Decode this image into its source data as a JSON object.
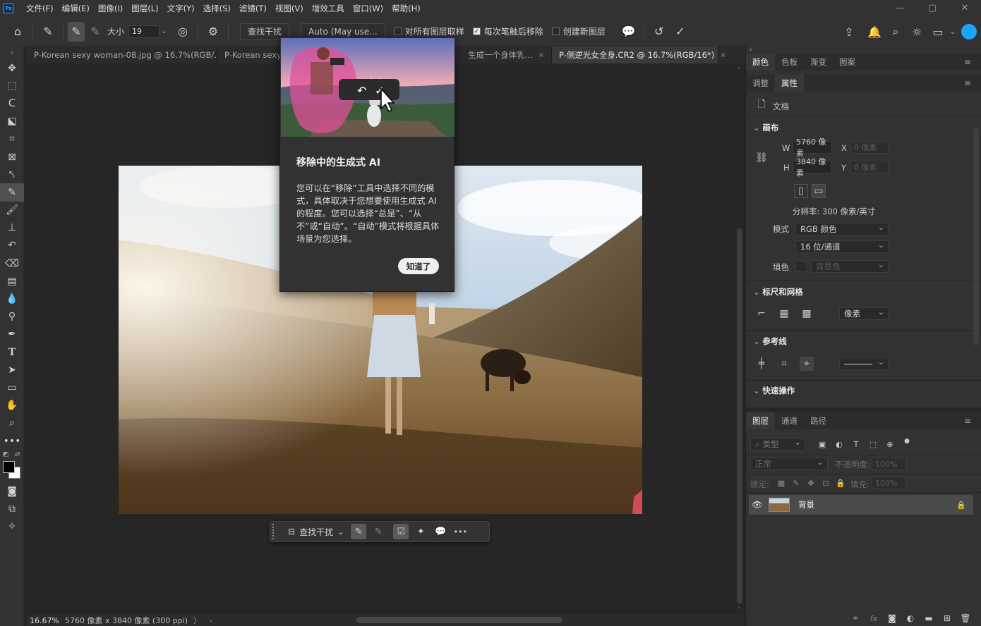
{
  "app": {
    "logo": "Ps",
    "menu": [
      "文件(F)",
      "编辑(E)",
      "图像(I)",
      "图层(L)",
      "文字(Y)",
      "选择(S)",
      "滤镜(T)",
      "视图(V)",
      "增效工具",
      "窗口(W)",
      "帮助(H)"
    ],
    "window_controls": [
      "—",
      "▢",
      "✕"
    ]
  },
  "options": {
    "size_label": "大小",
    "size_value": "19",
    "find_distractions": "查找干扰",
    "mode": "Auto (May use...",
    "sample_all_layers": "对所有图层取样",
    "remove_after_stroke": "每次笔触后移除",
    "create_new_layer": "创建新图层"
  },
  "tabs": [
    {
      "label": "P-Korean sexy woman-08.jpg @ 16.7%(RGB/..."
    },
    {
      "label": "P-Korean sexy w"
    },
    {
      "label": "生成一个身体乳..."
    },
    {
      "label": "P-侧逆光女全身.CR2 @ 16.7%(RGB/16*)"
    }
  ],
  "tab_close": "×",
  "status": {
    "zoom": "16.67%",
    "info": "5760 像素 x 3840 像素 (300 ppi)",
    "arrow": "〉",
    "left": "‹"
  },
  "contextbar": {
    "find_distractions": "查找干扰",
    "more": "•••"
  },
  "popup": {
    "title": "移除中的生成式 AI",
    "body": "您可以在“移除”工具中选择不同的模式，具体取决于您想要使用生成式 AI 的程度。您可以选择“总是”、“从不”或“自动”。“自动”模式将根据具体场景为您选择。",
    "ok": "知道了"
  },
  "panel_top": {
    "tabs": [
      "颜色",
      "色板",
      "渐变",
      "图案"
    ],
    "menu": "≡"
  },
  "panel_props": {
    "tabs": [
      "调整",
      "属性"
    ],
    "doc_label": "文档",
    "canvas_section": "画布",
    "w_label": "W",
    "w_value": "5760 像素",
    "h_label": "H",
    "h_value": "3840 像素",
    "x_label": "X",
    "x_value": "0 像素",
    "y_label": "Y",
    "y_value": "0 像素",
    "resolution": "分辨率: 300 像素/英寸",
    "mode_label": "模式",
    "mode_value": "RGB 颜色",
    "depth_value": "16 位/通道",
    "fill_label": "填色",
    "fill_value": "背景色",
    "rulers_section": "标尺和网格",
    "rulers_unit": "像素",
    "guides_section": "参考线",
    "quick_section": "快速操作"
  },
  "panel_layers": {
    "tabs": [
      "图层",
      "通道",
      "路径"
    ],
    "filter_placeholder": "类型",
    "blend_mode": "正常",
    "opacity_label": "不透明度:",
    "opacity_value": "100%",
    "lock_label": "锁定:",
    "fill_label": "填充:",
    "fill_value": "100%",
    "layer_name": "背景"
  },
  "colors": {
    "accent": "#31a8ff",
    "panel": "#323232",
    "canvas_bg": "#262626",
    "removal_overlay": "#e0509a"
  }
}
